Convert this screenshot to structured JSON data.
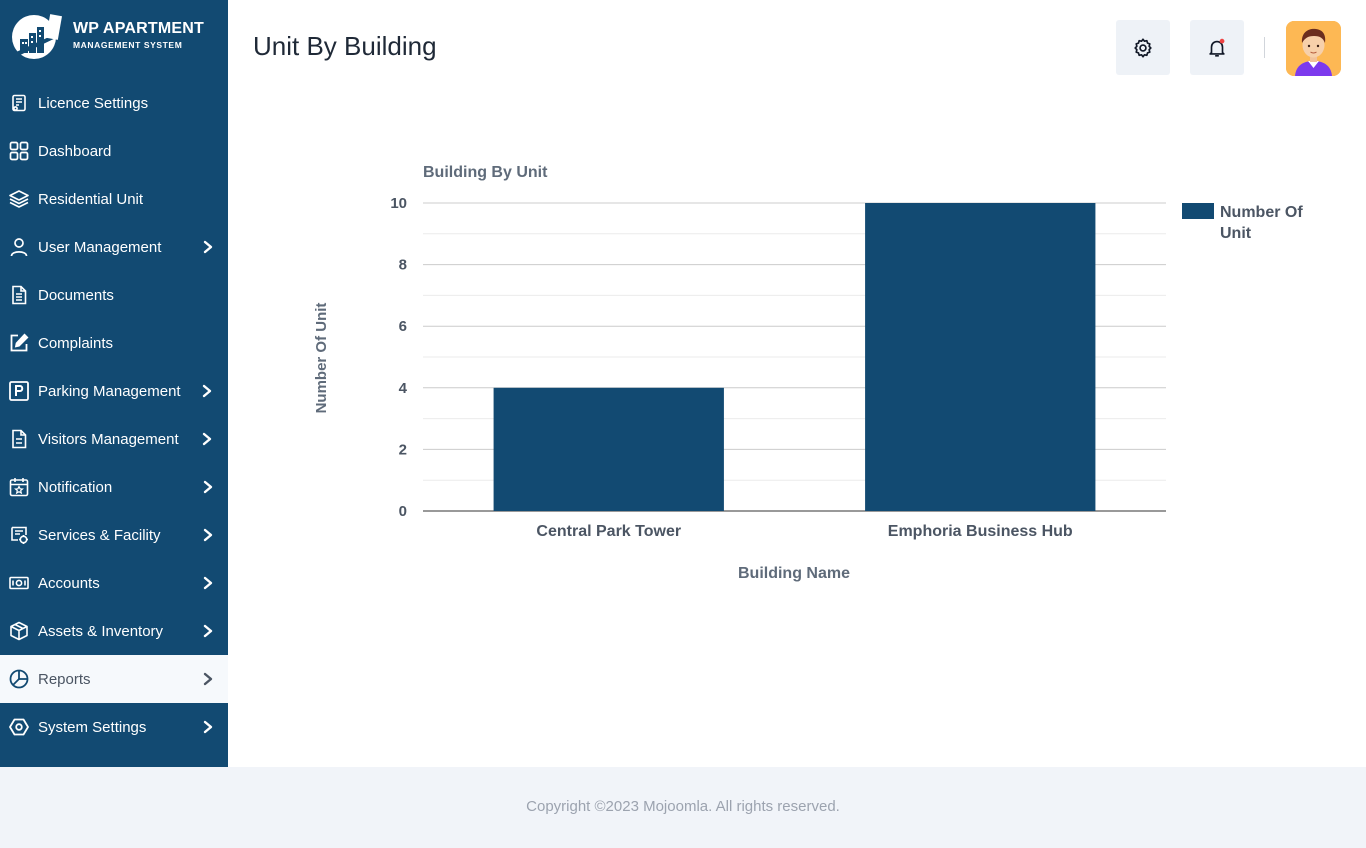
{
  "brand": {
    "title": "WP APARTMENT",
    "subtitle": "MANAGEMENT SYSTEM"
  },
  "sidebar": {
    "items": [
      {
        "label": "Licence Settings",
        "icon": "licence-icon",
        "has_chevron": false
      },
      {
        "label": "Dashboard",
        "icon": "dashboard-icon",
        "has_chevron": false
      },
      {
        "label": "Residential Unit",
        "icon": "layers-icon",
        "has_chevron": false
      },
      {
        "label": "User Management",
        "icon": "user-icon",
        "has_chevron": true
      },
      {
        "label": "Documents",
        "icon": "document-icon",
        "has_chevron": false
      },
      {
        "label": "Complaints",
        "icon": "edit-icon",
        "has_chevron": false
      },
      {
        "label": "Parking Management",
        "icon": "parking-icon",
        "has_chevron": true
      },
      {
        "label": "Visitors Management",
        "icon": "visitor-document-icon",
        "has_chevron": true
      },
      {
        "label": "Notification",
        "icon": "calendar-star-icon",
        "has_chevron": true
      },
      {
        "label": "Services & Facility",
        "icon": "service-icon",
        "has_chevron": true
      },
      {
        "label": "Accounts",
        "icon": "money-icon",
        "has_chevron": true
      },
      {
        "label": "Assets & Inventory",
        "icon": "box-icon",
        "has_chevron": true
      },
      {
        "label": "Reports",
        "icon": "pie-chart-icon",
        "has_chevron": true,
        "active": true
      },
      {
        "label": "System Settings",
        "icon": "hexagon-gear-icon",
        "has_chevron": true
      }
    ]
  },
  "header": {
    "title": "Unit By Building",
    "settings_icon": "gear-icon",
    "notification_icon": "bell-icon",
    "notification_dot_color": "#ef4444",
    "avatar_icon": "avatar-icon"
  },
  "chart_data": {
    "type": "bar",
    "title": "Building By Unit",
    "xlabel": "Building Name",
    "ylabel": "Number Of Unit",
    "categories": [
      "Central Park Tower",
      "Emphoria Business Hub"
    ],
    "series": [
      {
        "name": "Number Of Unit",
        "values": [
          4,
          10
        ],
        "color": "#124a72"
      }
    ],
    "ylim": [
      0,
      10
    ],
    "yticks": [
      0,
      2,
      4,
      6,
      8,
      10
    ],
    "grid": true,
    "legend": "right"
  },
  "footer": {
    "text": "Copyright ©2023 Mojoomla. All rights reserved."
  },
  "colors": {
    "sidebar_bg": "#124a72",
    "accent": "#124a72",
    "footer_bg": "#f1f4f9"
  }
}
